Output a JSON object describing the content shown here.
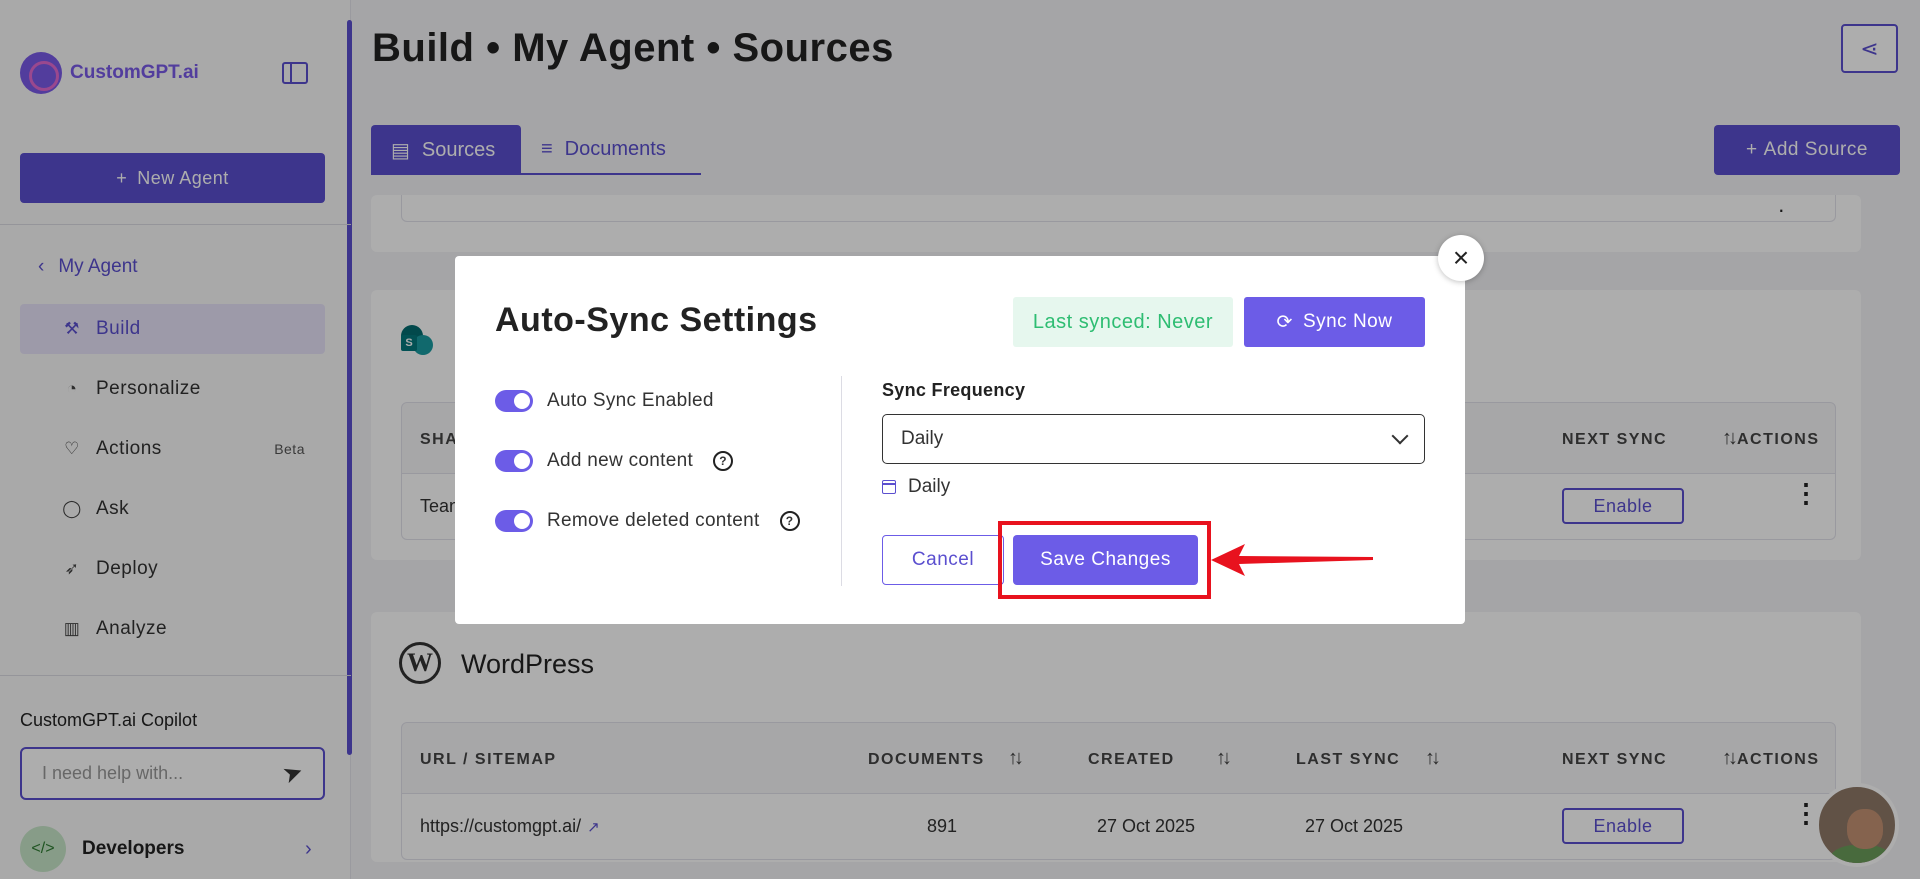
{
  "sidebar": {
    "logo_text": "CustomGPT.ai",
    "new_agent_label": "New Agent",
    "my_agent_label": "My Agent",
    "items": [
      {
        "label": "Build",
        "icon": "build-icon"
      },
      {
        "label": "Personalize",
        "icon": "palette-icon"
      },
      {
        "label": "Actions",
        "icon": "heart-icon",
        "badge": "Beta"
      },
      {
        "label": "Ask",
        "icon": "chat-icon"
      },
      {
        "label": "Deploy",
        "icon": "rocket-icon"
      },
      {
        "label": "Analyze",
        "icon": "chart-icon"
      }
    ],
    "copilot_title": "CustomGPT.ai Copilot",
    "copilot_placeholder": "I need help with...",
    "developers_label": "Developers"
  },
  "header": {
    "title": "Build • My Agent • Sources"
  },
  "tabs": [
    {
      "label": "Sources",
      "active": true
    },
    {
      "label": "Documents",
      "active": false
    }
  ],
  "add_source_label": "Add Source",
  "sharepoint": {
    "columns": [
      "SHA",
      "NEXT SYNC",
      "ACTIONS"
    ],
    "row": {
      "name": "Tean",
      "action": "Enable"
    }
  },
  "wordpress": {
    "title": "WordPress",
    "columns": [
      "URL / SITEMAP",
      "DOCUMENTS",
      "CREATED",
      "LAST SYNC",
      "NEXT SYNC",
      "ACTIONS"
    ],
    "row": {
      "url": "https://customgpt.ai/",
      "documents": "891",
      "created": "27 Oct 2025",
      "last_sync": "27 Oct 2025",
      "action": "Enable"
    }
  },
  "modal": {
    "title": "Auto-Sync Settings",
    "last_synced": "Last synced: Never",
    "sync_now_label": "Sync Now",
    "toggles": [
      {
        "label": "Auto Sync Enabled",
        "on": true,
        "help": false
      },
      {
        "label": "Add new content",
        "on": true,
        "help": true
      },
      {
        "label": "Remove deleted content",
        "on": true,
        "help": true
      }
    ],
    "frequency_label": "Sync Frequency",
    "frequency_value": "Daily",
    "frequency_note": "Daily",
    "cancel_label": "Cancel",
    "save_label": "Save Changes"
  },
  "colors": {
    "accent": "#5b4fcf",
    "button": "#6c5ce7",
    "success_text": "#2ebd72",
    "success_bg": "#e6f7ee",
    "annotation_red": "#e8121e"
  }
}
